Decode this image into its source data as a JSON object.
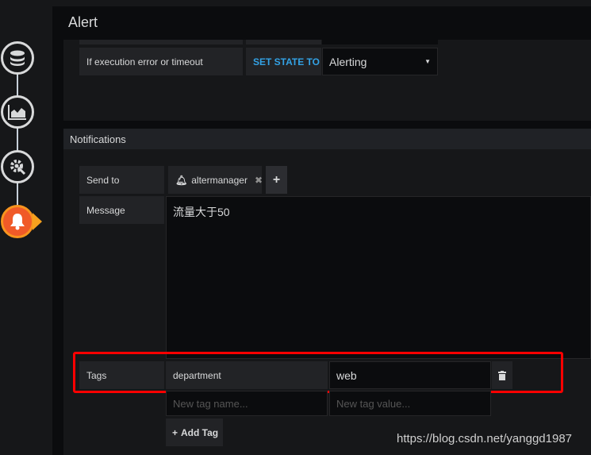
{
  "header": {
    "title": "Alert"
  },
  "sidebar": {
    "steps": [
      {
        "icon": "database-icon"
      },
      {
        "icon": "chart-area-icon"
      },
      {
        "icon": "gear-wrench-icon"
      },
      {
        "icon": "bell-icon",
        "active": true
      }
    ]
  },
  "conditions": {
    "error_label": "If execution error or timeout",
    "set_state_label": "SET STATE TO",
    "state_value": "Alerting"
  },
  "notifications": {
    "title": "Notifications",
    "send_to_label": "Send to",
    "channel": "altermanager",
    "message_label": "Message",
    "message": "流量大于50",
    "tags_label": "Tags",
    "tags": [
      {
        "name": "department",
        "value": "web"
      }
    ],
    "new_tag_name_placeholder": "New tag name...",
    "new_tag_value_placeholder": "New tag value...",
    "add_tag_label": "Add Tag"
  },
  "highlight_color": "#ff0000",
  "accent_color": "#33a2e5",
  "watermark": "https://blog.csdn.net/yanggd1987"
}
